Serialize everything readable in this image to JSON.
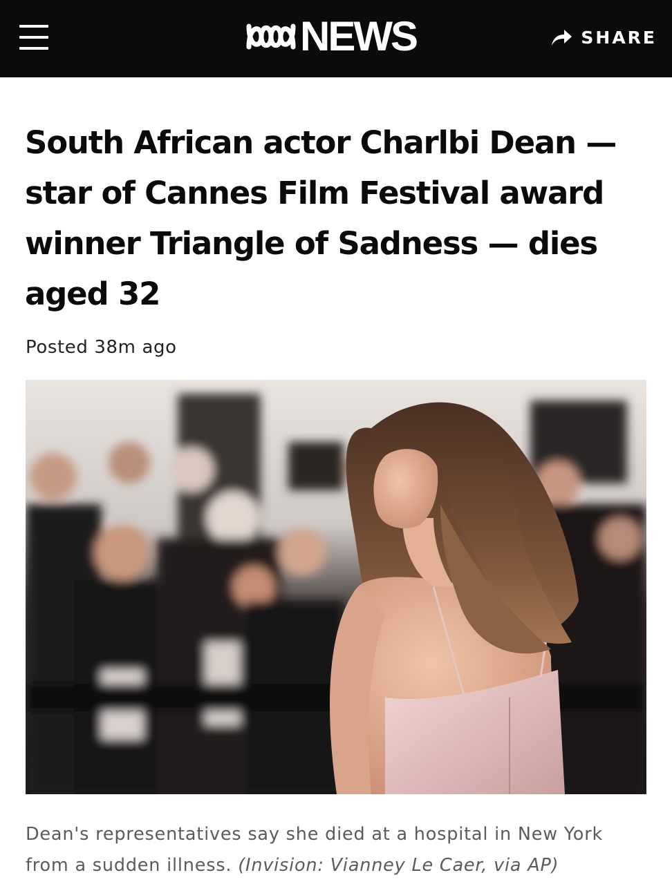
{
  "header": {
    "logo_text": "NEWS",
    "logo_brand": "ABC NEWS",
    "menu_icon": "hamburger-menu-icon",
    "share_icon": "share-arrow-icon",
    "share_label": "SHARE",
    "background_color": "#0b0b0b"
  },
  "article": {
    "headline": "South African actor Charlbi Dean — star of Cannes Film Festival award winner Triangle of Sadness — dies aged 32",
    "posted": "Posted 38m ago"
  },
  "photo": {
    "caption": "Dean's representatives say she died at a hospital in New York from a sudden illness.",
    "credit": "(Invision: Vianney Le Caer, via AP)"
  }
}
